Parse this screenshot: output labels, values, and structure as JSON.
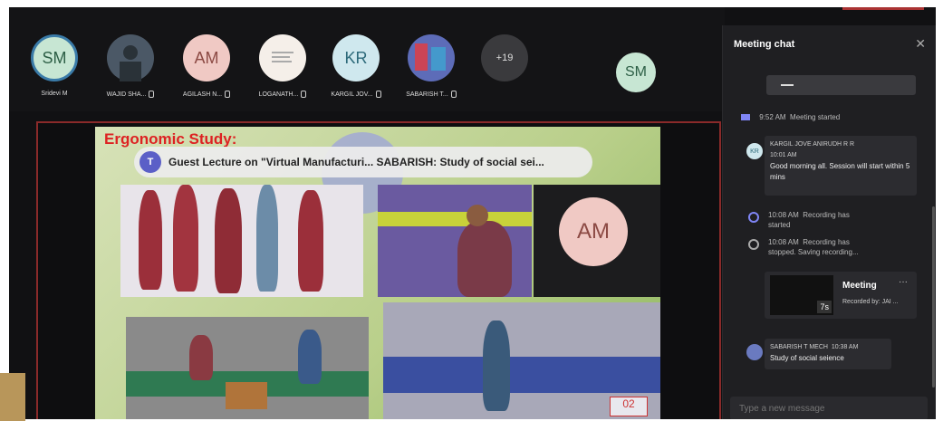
{
  "gallery": {
    "participants": [
      {
        "initials": "SM",
        "name": "Sridevi M",
        "bg": "#c7e6d3",
        "fg": "#2d5f46",
        "ring": true
      },
      {
        "initials": "",
        "name": "WAJID SHA...",
        "bg": "#5a6a7a",
        "fg": "#fff",
        "photo": true
      },
      {
        "initials": "AM",
        "name": "AGILASH N...",
        "bg": "#f0c9c4",
        "fg": "#8c4a44"
      },
      {
        "initials": "",
        "name": "LOGANATH...",
        "bg": "#f5f0ec",
        "fg": "#888",
        "photo": true
      },
      {
        "initials": "KR",
        "name": "KARGIL JOV...",
        "bg": "#cfe8ee",
        "fg": "#2d6a7a"
      },
      {
        "initials": "",
        "name": "SABARISH T...",
        "bg": "#6a7ac0",
        "fg": "#fff",
        "photo": true
      },
      {
        "initials": "+19",
        "name": "",
        "bg": "#3a3a3d",
        "fg": "#ddd"
      }
    ],
    "self_view": "SM"
  },
  "share": {
    "slide_title": "Ergonomic Study:",
    "banner_text": "Guest Lecture on \"Virtual Manufacturi...  SABARISH: Study of social sei...",
    "floating_avatar": "AM"
  },
  "chat": {
    "title": "Meeting chat",
    "close": "✕",
    "meeting_started_time": "9:52 AM",
    "meeting_started_text": "Meeting started",
    "msg1": {
      "sender": "KARGIL JOVE ANIRUDH R R",
      "time": "10:01 AM",
      "text": "Good morning all. Session will start within 5 mins",
      "avatar": "KR"
    },
    "rec1": {
      "time": "10:08 AM",
      "text": "Recording has started"
    },
    "rec2": {
      "time": "10:08 AM",
      "text": "Recording has stopped. Saving recording..."
    },
    "card": {
      "title": "Meeting",
      "sub": "Recorded by: JAI ...",
      "duration": "7s",
      "more": "···"
    },
    "msg2": {
      "sender": "SABARISH T MECH",
      "time": "10:38 AM",
      "text": "Study of social seience"
    },
    "input_placeholder": "Type a new message"
  }
}
